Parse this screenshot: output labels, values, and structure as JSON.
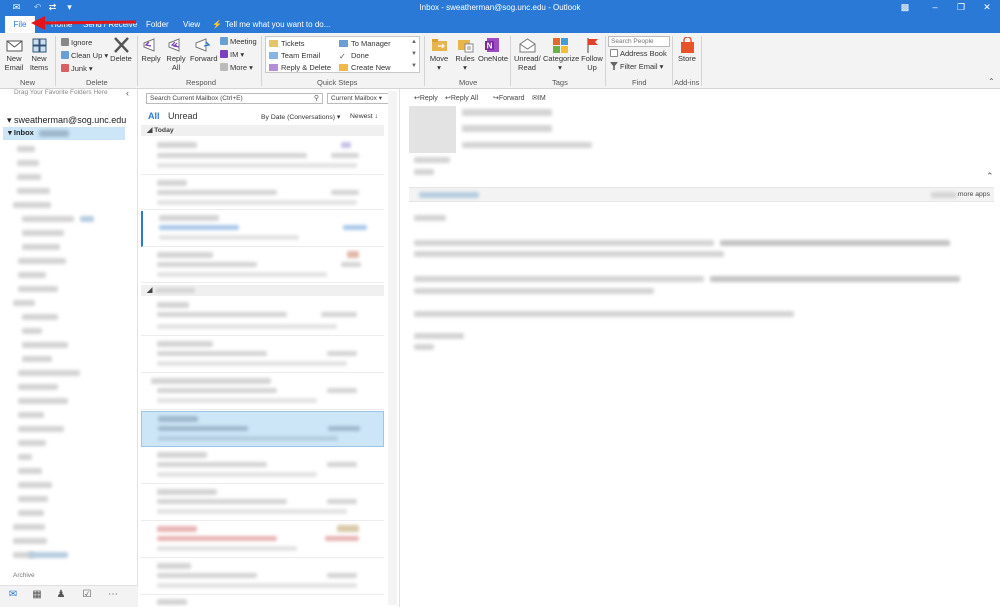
{
  "window": {
    "title": "Inbox - sweatherman@sog.unc.edu - Outlook"
  },
  "tabs": [
    {
      "label": "File",
      "active": true
    },
    {
      "label": "Home",
      "active": false
    },
    {
      "label": "Send / Receive",
      "active": false
    },
    {
      "label": "Folder",
      "active": false
    },
    {
      "label": "View",
      "active": false
    }
  ],
  "tell_me": "Tell me what you want to do...",
  "ribbon": {
    "new_group": {
      "new_email": "New\nEmail",
      "new_items": "New\nItems",
      "label": "New"
    },
    "delete_group": {
      "ignore": "Ignore",
      "clean_up": "Clean Up",
      "junk": "Junk",
      "delete": "Delete",
      "label": "Delete"
    },
    "respond_group": {
      "reply": "Reply",
      "reply_all": "Reply\nAll",
      "forward": "Forward",
      "meeting": "Meeting",
      "im": "IM",
      "more": "More",
      "label": "Respond"
    },
    "quick_steps": {
      "items": [
        "Tickets",
        "Team Email",
        "Reply & Delete",
        "To Manager",
        "Done",
        "Create New"
      ],
      "label": "Quick Steps"
    },
    "move_group": {
      "move": "Move",
      "rules": "Rules",
      "onenote": "OneNote",
      "label": "Move"
    },
    "tags_group": {
      "unread_read": "Unread/\nRead",
      "categorize": "Categorize",
      "follow_up": "Follow\nUp",
      "label": "Tags"
    },
    "find_group": {
      "search_people": "Search People",
      "address_book": "Address Book",
      "filter_email": "Filter Email",
      "label": "Find"
    },
    "addins_group": {
      "store": "Store",
      "label": "Add-ins"
    }
  },
  "folder_pane": {
    "drag_hint": "Drag Your Favorite Folders Here",
    "account": "sweatherman@sog.unc.edu",
    "inbox": "Inbox",
    "bottom_label": "Archive"
  },
  "mail_list": {
    "search_placeholder": "Search Current Mailbox (Ctrl+E)",
    "scope": "Current Mailbox",
    "filter_all": "All",
    "filter_unread": "Unread",
    "sort_by": "By Date (Conversations)",
    "order": "Newest",
    "group_today": "Today"
  },
  "reading_pane": {
    "actions": [
      "Reply",
      "Reply All",
      "Forward",
      "IM"
    ],
    "more_apps": "more apps"
  },
  "colors": {
    "accent": "#2b79d6",
    "annotation_arrow": "#e0161b"
  }
}
